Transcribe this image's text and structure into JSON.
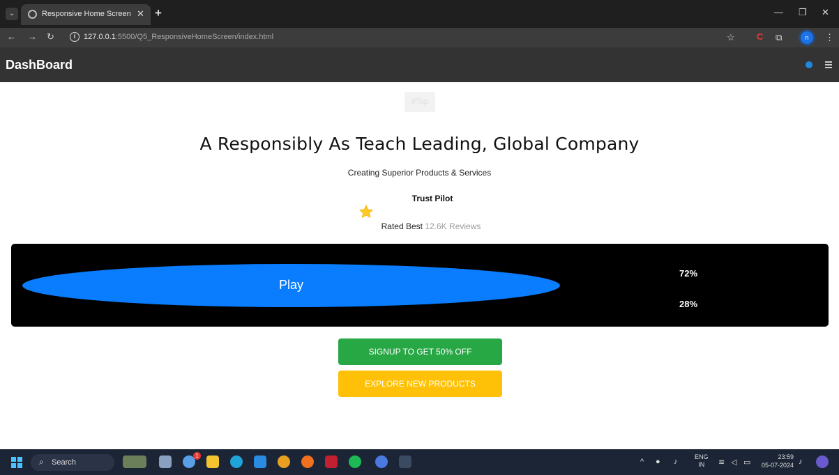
{
  "browser": {
    "tab_title": "Responsive Home Screen",
    "url_host": "127.0.0.1",
    "url_path": ":5500/Q5_ResponsiveHomeScreen/index.html"
  },
  "header": {
    "brand": "DashBoard"
  },
  "content": {
    "top_button": "#Top",
    "headline": "A Responsibly As Teach Leading, Global Company",
    "subhead": "Creating Superior Products & Services",
    "trust_label": "Trust Pilot",
    "rated_prefix": "Rated Best",
    "rated_count": "12.6K Reviews",
    "play_label": "Play",
    "percent_a": "72%",
    "percent_b": "28%",
    "signup_button": "SIGNUP TO GET 50% OFF",
    "explore_button": "EXPLORE NEW PRODUCTS"
  },
  "taskbar": {
    "search_label": "Search",
    "notification_count": "1",
    "lang_top": "ENG",
    "lang_bottom": "IN",
    "time": "23:59",
    "date": "05-07-2024"
  },
  "colors": {
    "header_bg": "#333333",
    "play_blue": "#0a7dff",
    "signup_green": "#28a745",
    "explore_yellow": "#ffc107",
    "star_yellow": "#ffca28"
  }
}
